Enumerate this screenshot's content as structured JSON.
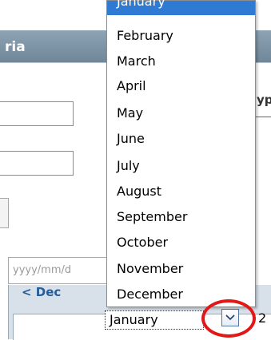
{
  "panel": {
    "title_fragment": "ria"
  },
  "right_label_fragment": "yp",
  "date_field": {
    "placeholder": "yyyy/mm/d"
  },
  "calendar": {
    "prev_link": "< Dec",
    "month_select_value": "January",
    "year_fragment": "2"
  },
  "dropdown": {
    "selected": "January",
    "items": [
      "February",
      "March",
      "April",
      "May",
      "June",
      "July",
      "August",
      "September",
      "October",
      "November",
      "December"
    ]
  },
  "colors": {
    "highlight": "#2f7ad2",
    "annotation_ring": "#e01818"
  }
}
